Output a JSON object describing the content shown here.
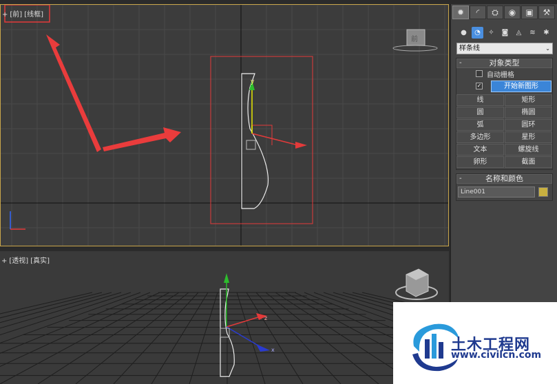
{
  "front_viewport": {
    "labels": [
      "+",
      "[前]",
      "[线框]"
    ]
  },
  "persp_viewport": {
    "labels": [
      "+",
      "[透视]",
      "[真实]"
    ]
  },
  "viewcube": {
    "front_face_label": "前"
  },
  "command_panel": {
    "tabs": [
      {
        "icon": "sun-create-icon",
        "glyph": "✹"
      },
      {
        "icon": "modify-arc-icon",
        "glyph": "◜"
      },
      {
        "icon": "hierarchy-icon",
        "glyph": "⛭"
      },
      {
        "icon": "motion-icon",
        "glyph": "◉"
      },
      {
        "icon": "display-monitor-icon",
        "glyph": "▣"
      },
      {
        "icon": "utilities-hammer-icon",
        "glyph": "⚒"
      }
    ],
    "categories": [
      {
        "icon": "geometry-sphere-icon",
        "glyph": "●"
      },
      {
        "icon": "shapes-icon",
        "glyph": "◔"
      },
      {
        "icon": "lights-icon",
        "glyph": "✧"
      },
      {
        "icon": "cameras-icon",
        "glyph": "◙"
      },
      {
        "icon": "helpers-icon",
        "glyph": "◬"
      },
      {
        "icon": "spacewarps-icon",
        "glyph": "≋"
      },
      {
        "icon": "systems-icon",
        "glyph": "✱"
      }
    ],
    "dropdown_value": "样条线",
    "object_type": {
      "header": "对象类型",
      "auto_grid_label": "自动栅格",
      "start_new_shape_label": "开始新图形",
      "buttons": [
        "线",
        "矩形",
        "圆",
        "椭圆",
        "弧",
        "圆环",
        "多边形",
        "星形",
        "文本",
        "螺旋线",
        "卵形",
        "截面"
      ]
    },
    "name_color": {
      "header": "名称和颜色",
      "name_value": "Line001",
      "object_color": "#c8b040"
    }
  },
  "axis_labels": {
    "front_y": "y",
    "persp_z": "z",
    "persp_x": "x"
  },
  "watermark": {
    "title": "土木工程网",
    "url": "www.civilcn.com"
  },
  "colors": {
    "viewport_bg": "#3c3c3c",
    "active_border": "#c9a64a",
    "selection": "#e33a3a",
    "accent_blue": "#3b85d8"
  }
}
